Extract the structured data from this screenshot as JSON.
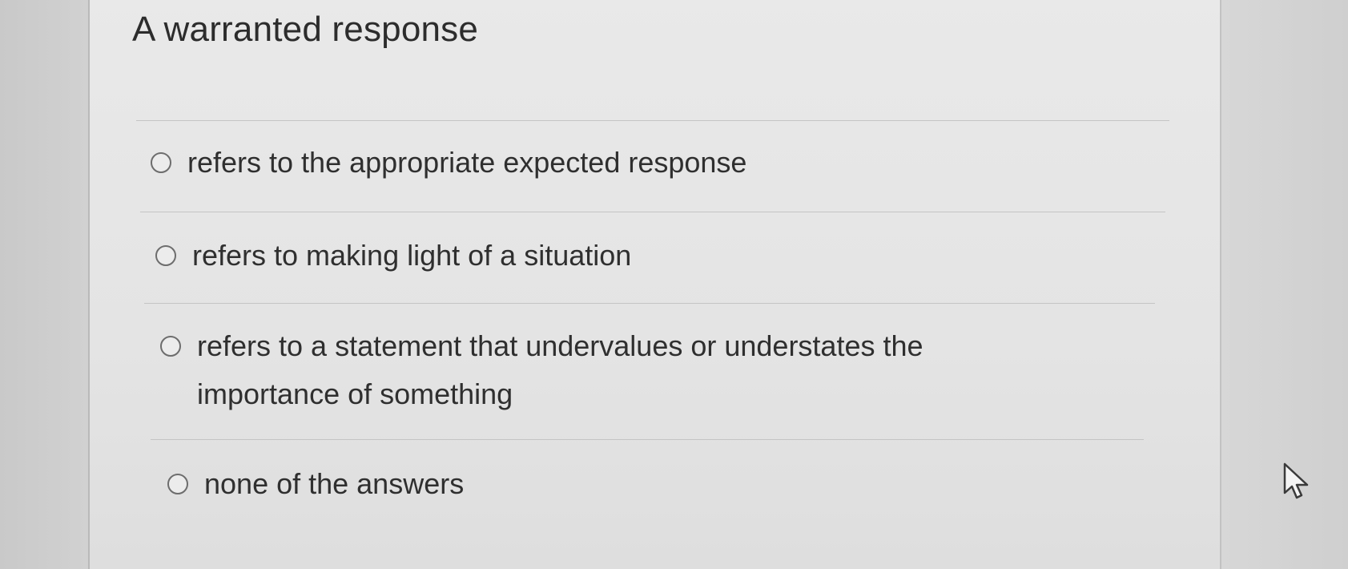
{
  "question": {
    "title": "A warranted response"
  },
  "options": [
    {
      "label": "refers to the appropriate expected response"
    },
    {
      "label": "refers to making light of a situation"
    },
    {
      "label": "refers to a statement that undervalues or understates the importance of something"
    },
    {
      "label": "none of the answers"
    }
  ],
  "icons": {
    "radio": "radio-unselected-icon",
    "cursor": "mouse-pointer-icon"
  }
}
